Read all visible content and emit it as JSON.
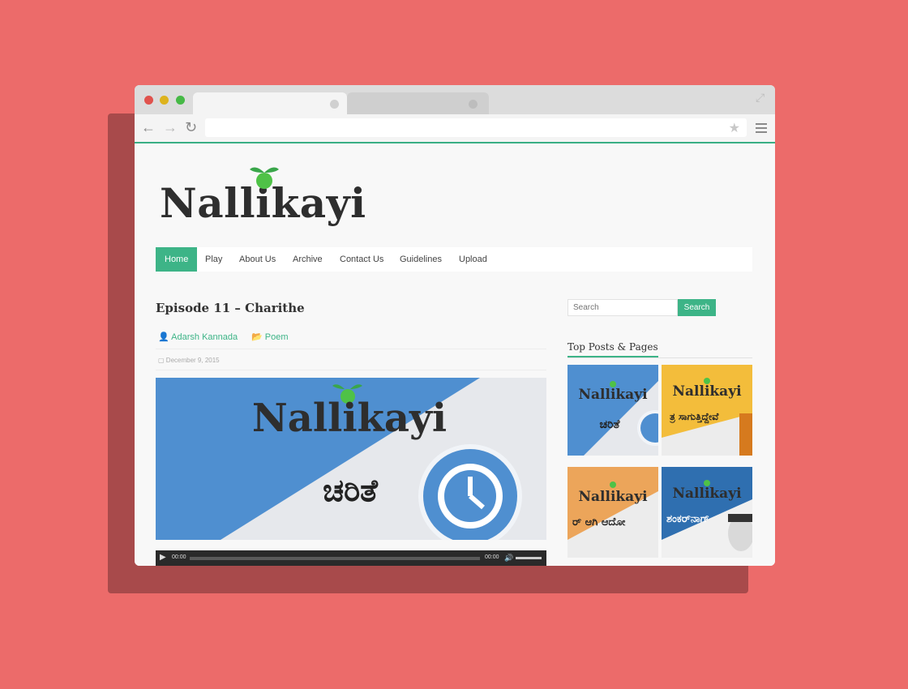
{
  "browser": {
    "tabs": [
      {
        "label": ""
      },
      {
        "label": ""
      }
    ],
    "url": ""
  },
  "site": {
    "logo_text": "Nallikayi",
    "accent": "#3db487"
  },
  "nav": {
    "items": [
      "Home",
      "Play",
      "About Us",
      "Archive",
      "Contact Us",
      "Guidelines",
      "Upload"
    ],
    "active": "Home"
  },
  "post": {
    "title": "Episode 11 – Charithe",
    "author": "Adarsh Kannada",
    "category": "Poem",
    "date": "December 9, 2015",
    "image_logo": "Nallikayi",
    "image_caption": "ಚರಿತೆ"
  },
  "audio": {
    "current": "00:00",
    "duration": "00:00"
  },
  "sidebar": {
    "search_placeholder": "Search",
    "search_button": "Search",
    "widget_title": "Top Posts & Pages",
    "thumbs": [
      {
        "logo": "Nallikayi",
        "caption": "ಚರಿತೆ",
        "bg": "#4f8fd0"
      },
      {
        "logo": "Nallikayi",
        "caption": "ತ್ರ ಸಾಗುತ್ತಿದ್ದೇವೆ",
        "bg": "#f3bd3b"
      },
      {
        "logo": "Nallikayi",
        "caption": "ರ್ ಆಗಿ ಆದೋ",
        "bg": "#eca55a"
      },
      {
        "logo": "Nallikayi",
        "caption": "ಶಂಕರ್‌ನಾಗ್",
        "bg": "#2f6fb0"
      }
    ]
  }
}
